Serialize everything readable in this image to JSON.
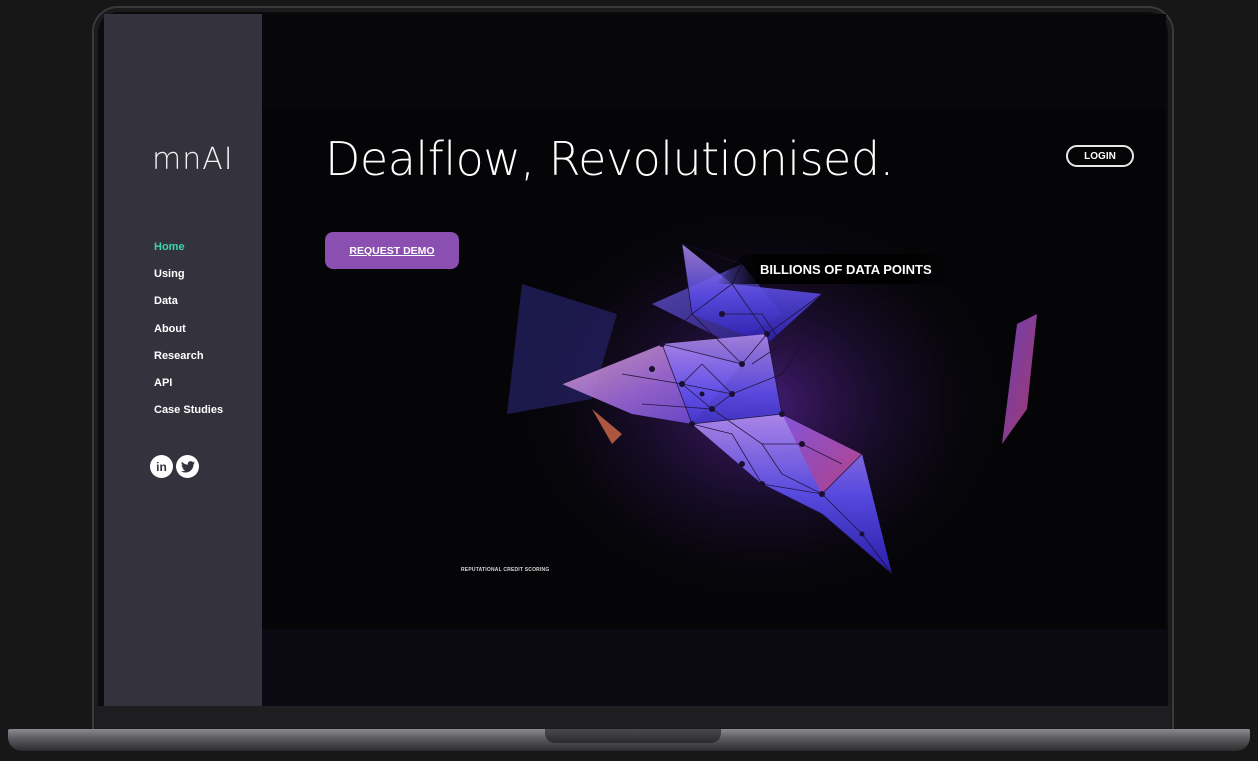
{
  "sidebar": {
    "logo": "mnAI",
    "nav": [
      "Home",
      "Using",
      "Data",
      "About",
      "Research",
      "API",
      "Case Studies"
    ],
    "active_index": 0,
    "social": [
      {
        "icon": "linkedin-icon",
        "glyph": "in"
      },
      {
        "icon": "twitter-icon",
        "glyph": "✓"
      }
    ]
  },
  "header": {
    "headline": "Dealflow, Revolutionised.",
    "login_label": "LOGIN"
  },
  "hero": {
    "demo_label": "REQUEST DEMO",
    "data_label": "BILLIONS OF DATA POINTS",
    "caption": "REPUTATIONAL CREDIT SCORING"
  },
  "colors": {
    "sidebar_bg": "#34323d",
    "accent_purple": "#8a4fb0",
    "active_nav": "#3ed6a6"
  }
}
